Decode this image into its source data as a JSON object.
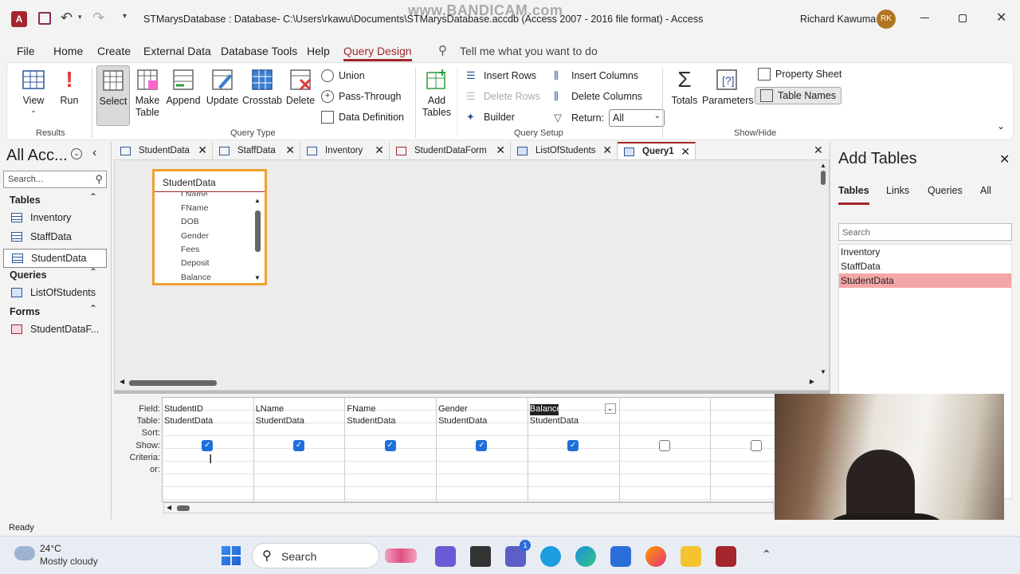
{
  "titlebar": {
    "title": "STMarysDatabase : Database- C:\\Users\\rkawu\\Documents\\STMarysDatabase.accdb (Access 2007 - 2016 file format)  -  Access",
    "watermark": "www.BANDICAM.com",
    "user": "Richard Kawuma",
    "avatar_initials": "RK"
  },
  "menu": {
    "items": [
      "File",
      "Home",
      "Create",
      "External Data",
      "Database Tools",
      "Help",
      "Query Design"
    ],
    "tell_me": "Tell me what you want to do"
  },
  "ribbon": {
    "results": {
      "label": "Results",
      "view": "View",
      "run": "Run"
    },
    "query_type": {
      "label": "Query Type",
      "select": "Select",
      "make_table": "Make Table",
      "append": "Append",
      "update": "Update",
      "crosstab": "Crosstab",
      "delete": "Delete",
      "union": "Union",
      "pass_through": "Pass-Through",
      "data_definition": "Data Definition"
    },
    "query_setup": {
      "label": "Query Setup",
      "add_tables": "Add Tables",
      "insert_rows": "Insert Rows",
      "delete_rows": "Delete Rows",
      "builder": "Builder",
      "insert_columns": "Insert Columns",
      "delete_columns": "Delete Columns",
      "return_label": "Return:",
      "return_value": "All"
    },
    "show_hide": {
      "label": "Show/Hide",
      "totals": "Totals",
      "parameters": "Parameters",
      "property_sheet": "Property Sheet",
      "table_names": "Table Names"
    }
  },
  "nav": {
    "title": "All Acc...",
    "search_placeholder": "Search...",
    "tables_header": "Tables",
    "tables": [
      "Inventory",
      "StaffData",
      "StudentData"
    ],
    "queries_header": "Queries",
    "queries": [
      "ListOfStudents"
    ],
    "forms_header": "Forms",
    "forms": [
      "StudentDataF..."
    ]
  },
  "tabs": [
    "StudentData",
    "StaffData",
    "Inventory",
    "StudentDataForm",
    "ListOfStudents",
    "Query1"
  ],
  "table_box": {
    "title": "StudentData",
    "partial": "LName",
    "fields": [
      "FName",
      "DOB",
      "Gender",
      "Fees",
      "Deposit",
      "Balance"
    ]
  },
  "grid": {
    "row_labels": [
      "Field:",
      "Table:",
      "Sort:",
      "Show:",
      "Criteria:",
      "or:"
    ],
    "columns": [
      {
        "field": "StudentID",
        "table": "StudentData",
        "show": true
      },
      {
        "field": "LName",
        "table": "StudentData",
        "show": true
      },
      {
        "field": "FName",
        "table": "StudentData",
        "show": true
      },
      {
        "field": "Gender",
        "table": "StudentData",
        "show": true
      },
      {
        "field": "Balance",
        "table": "StudentData",
        "show": true
      },
      {
        "field": "",
        "table": "",
        "show": false
      },
      {
        "field": "",
        "table": "",
        "show": false
      }
    ]
  },
  "add_tables": {
    "title": "Add Tables",
    "tabs": [
      "Tables",
      "Links",
      "Queries",
      "All"
    ],
    "search_placeholder": "Search",
    "items": [
      "Inventory",
      "StaffData",
      "StudentData"
    ]
  },
  "status": {
    "text": "Ready"
  },
  "taskbar": {
    "temperature": "24°C",
    "weather": "Mostly cloudy",
    "search": "Search",
    "badge": "1"
  },
  "colors": {
    "accent": "#a4262c",
    "highlight": "#f4a6a6",
    "table_border": "#f0a030",
    "check": "#1e6fd9"
  }
}
